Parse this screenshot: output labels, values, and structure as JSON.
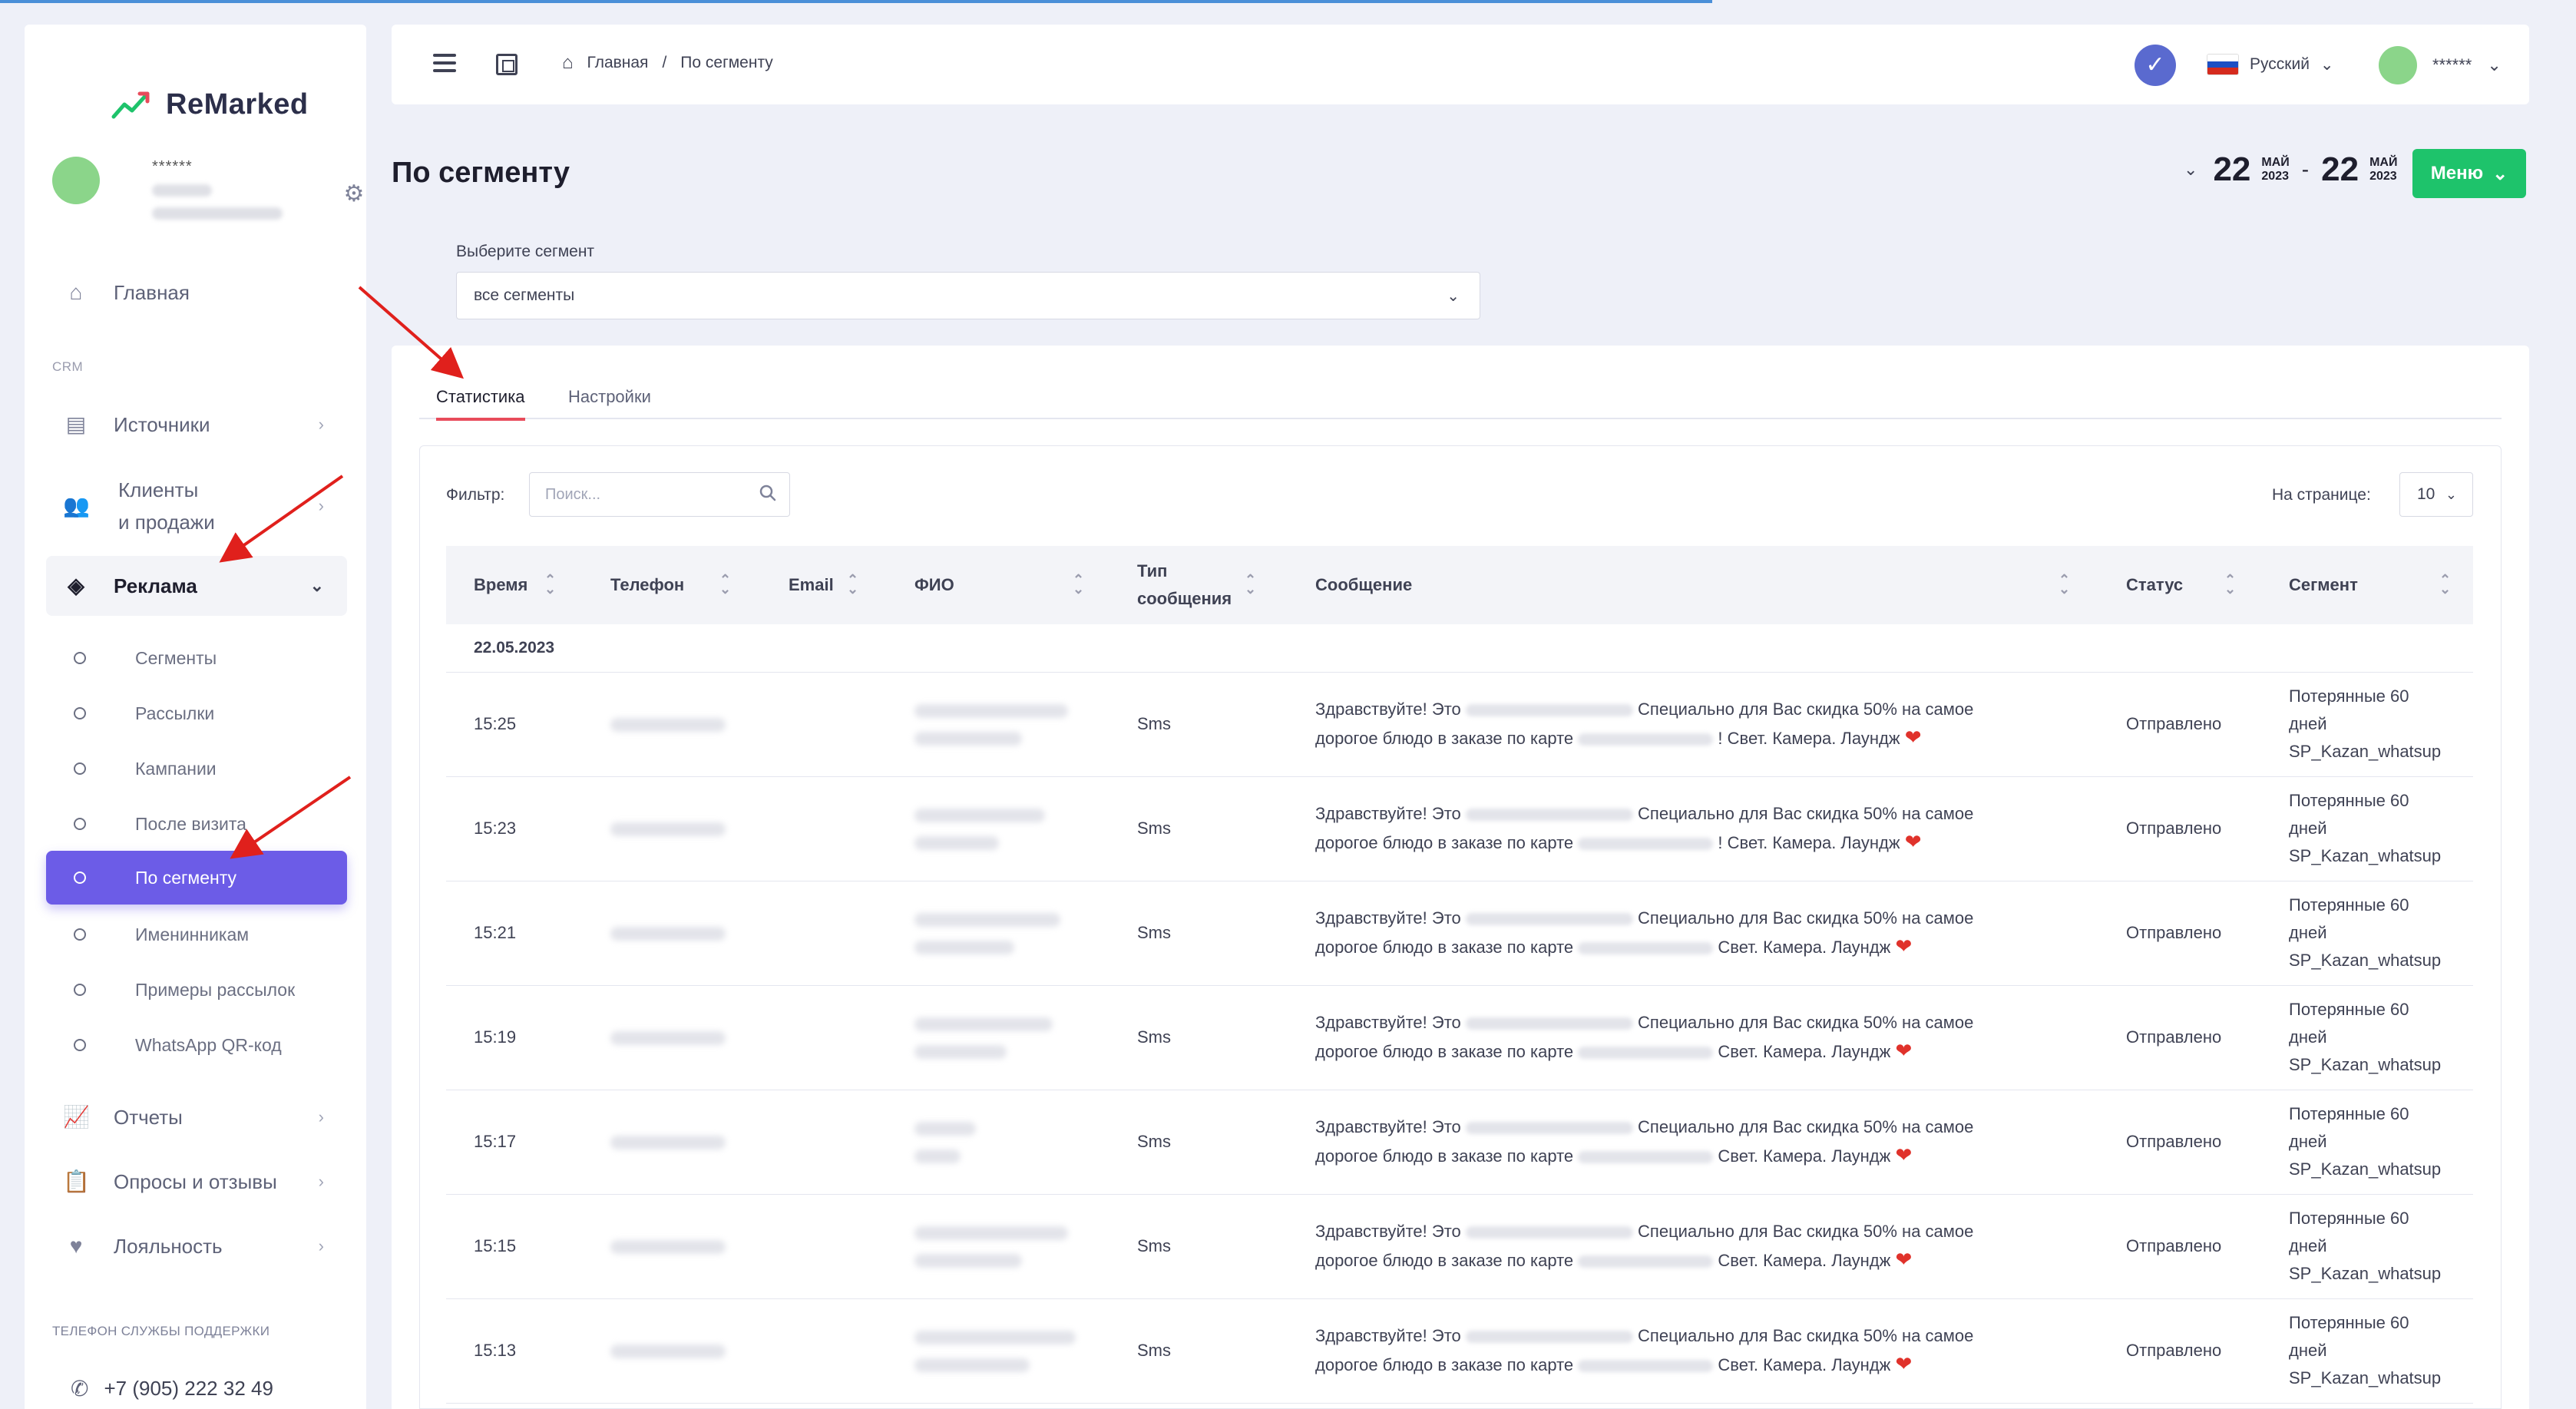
{
  "app": {
    "logo_text": "ReMarked"
  },
  "user": {
    "name": "******"
  },
  "sidebar": {
    "home": "Главная",
    "crm_label": "CRM",
    "sources": "Источники",
    "clients_line1": "Клиенты",
    "clients_line2": "и продажи",
    "ads": "Реклама",
    "ads_sub": [
      {
        "label": "Сегменты"
      },
      {
        "label": "Рассылки"
      },
      {
        "label": "Кампании"
      },
      {
        "label": "После визита"
      },
      {
        "label": "По сегменту"
      },
      {
        "label": "Именинникам"
      },
      {
        "label": "Примеры рассылок"
      },
      {
        "label": "WhatsApp QR-код"
      }
    ],
    "reports": "Отчеты",
    "surveys": "Опросы и отзывы",
    "loyalty": "Лояльность",
    "support_label": "ТЕЛЕФОН СЛУЖБЫ ПОДДЕРЖКИ",
    "support_phone": "+7 (905) 222 32 49"
  },
  "header": {
    "breadcrumb_home": "Главная",
    "breadcrumb_sep": "/",
    "breadcrumb_current": "По сегменту",
    "language": "Русский",
    "user_name": "******"
  },
  "page": {
    "title": "По сегменту",
    "date_from_day": "22",
    "date_from_month": "МАЙ",
    "date_from_year": "2023",
    "date_sep": "-",
    "date_to_day": "22",
    "date_to_month": "МАЙ",
    "date_to_year": "2023",
    "menu_button": "Меню"
  },
  "segment": {
    "label": "Выберите сегмент",
    "value": "все сегменты"
  },
  "tabs": {
    "stats": "Статистика",
    "settings": "Настройки"
  },
  "filter": {
    "label": "Фильтр:",
    "placeholder": "Поиск...",
    "per_page_label": "На странице:",
    "per_page_value": "10"
  },
  "table": {
    "headers": {
      "time": "Время",
      "phone": "Телефон",
      "email": "Email",
      "fio": "ФИО",
      "type_line1": "Тип",
      "type_line2": "сообщения",
      "message": "Сообщение",
      "status": "Статус",
      "segment": "Сегмент"
    },
    "group_date": "22.05.2023",
    "msg_start": "Здравствуйте! Это",
    "msg_mid": "Специально для Вас скидка 50% на самое",
    "msg_line2_start": "дорогое блюдо в заказе по карте",
    "msg_line2_end": "! Свет. Камера. Лаундж",
    "msg_line2_end_plain": "Свет. Камера. Лаундж",
    "type": "Sms",
    "status": "Отправлено",
    "seg_line1": "Потерянные 60",
    "seg_line2": "дней",
    "seg_line3": "SP_Kazan_whatsup",
    "rows": [
      {
        "time": "15:25"
      },
      {
        "time": "15:23"
      },
      {
        "time": "15:21"
      },
      {
        "time": "15:19"
      },
      {
        "time": "15:17"
      },
      {
        "time": "15:15"
      },
      {
        "time": "15:13"
      }
    ]
  },
  "colors": {
    "accent": "#6c5ce7",
    "menu_button": "#1ec36b",
    "tab_underline": "#e84b5b",
    "arrow": "#e0201c"
  }
}
